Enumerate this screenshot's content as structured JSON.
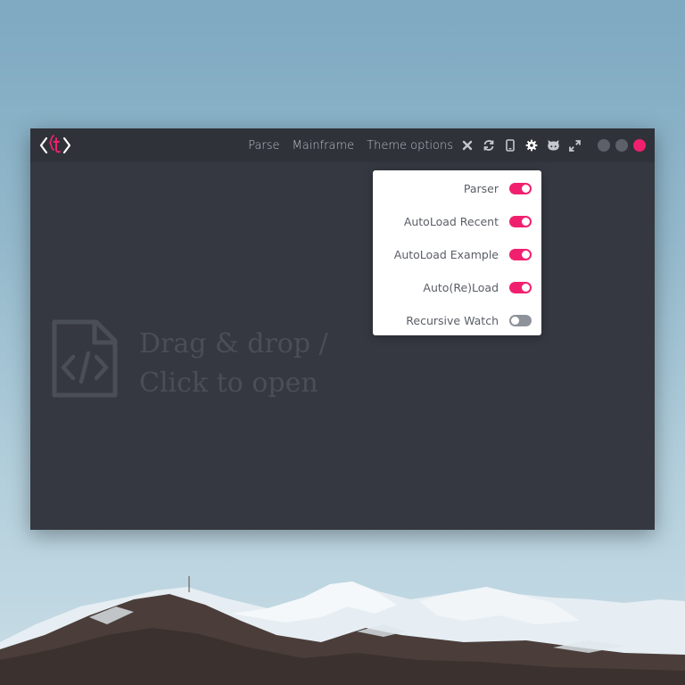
{
  "colors": {
    "accent": "#f0206e",
    "toggle_off": "#8d929b",
    "window_bg": "#353840",
    "titlebar_bg": "#2f3239",
    "window_dot_gray": "#5d6068"
  },
  "nav": {
    "items": [
      {
        "label": "Parse"
      },
      {
        "label": "Mainframe"
      },
      {
        "label": "Theme options"
      }
    ]
  },
  "toolbar": {
    "icons": [
      "close-icon",
      "refresh-icon",
      "mobile-icon",
      "gear-icon",
      "github-icon",
      "expand-icon"
    ]
  },
  "window_controls": [
    "minimize-dot",
    "maximize-dot",
    "close-dot"
  ],
  "dropzone": {
    "line1": "Drag & drop /",
    "line2": "Click to open",
    "icon": "code-file-icon"
  },
  "settings_menu": {
    "items": [
      {
        "label": "Parser",
        "enabled": true
      },
      {
        "label": "AutoLoad Recent",
        "enabled": true
      },
      {
        "label": "AutoLoad Example",
        "enabled": true
      },
      {
        "label": "Auto(Re)Load",
        "enabled": true
      },
      {
        "label": "Recursive Watch",
        "enabled": false
      }
    ]
  }
}
